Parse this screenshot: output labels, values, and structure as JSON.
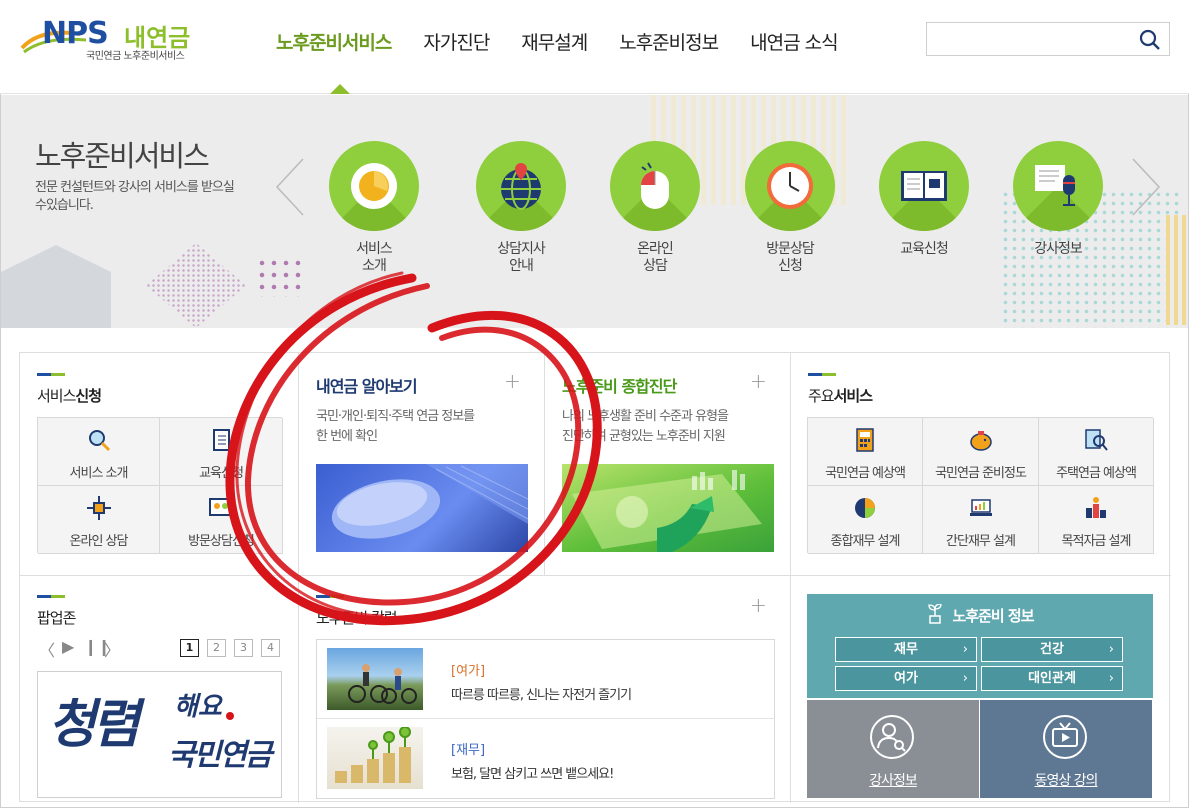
{
  "header": {
    "logo_nps": "NPS",
    "logo_name": "내연금",
    "logo_sub": "국민연금 노후준비서비스",
    "nav": [
      "노후준비서비스",
      "자가진단",
      "재무설계",
      "노후준비정보",
      "내연금 소식"
    ],
    "active_nav": 0,
    "search_placeholder": ""
  },
  "banner": {
    "title": "노후준비서비스",
    "desc": "전문 컨설턴트와 강사의 서비스를 받으실 수있습니다.",
    "services": [
      {
        "label": "서비스\n소개",
        "l1": "서비스",
        "l2": "소개",
        "icon": "clock-plate-icon"
      },
      {
        "label": "상담지사\n안내",
        "l1": "상담지사",
        "l2": "안내",
        "icon": "globe-pin-icon"
      },
      {
        "label": "온라인\n상담",
        "l1": "온라인",
        "l2": "상담",
        "icon": "mouse-icon"
      },
      {
        "label": "방문상담\n신청",
        "l1": "방문상담",
        "l2": "신청",
        "icon": "clock-icon"
      },
      {
        "label": "교육신청",
        "l1": "교육신청",
        "l2": "",
        "icon": "book-icon"
      },
      {
        "label": "강사정보",
        "l1": "강사정보",
        "l2": "",
        "icon": "microphone-icon"
      }
    ]
  },
  "service_apply": {
    "title_a": "서비스",
    "title_b": "신청",
    "items": [
      "서비스 소개",
      "교육신청",
      "온라인 상담",
      "방문상담신청"
    ]
  },
  "card1": {
    "title": "내연금 알아보기",
    "desc1": "국민·개인·퇴직·주택 연금 정보를",
    "desc2": "한 번에 확인"
  },
  "card2": {
    "title": "노후준비 종합진단",
    "desc1": "나의 노후생활 준비 수준과 유형을",
    "desc2": "진단하여 균형있는 노후준비 지원"
  },
  "main_services": {
    "title_a": "주요",
    "title_b": "서비스",
    "items": [
      "국민연금 예상액",
      "국민연금 준비정도",
      "주택연금 예상액",
      "종합재무 설계",
      "간단재무 설계",
      "목적자금 설계"
    ]
  },
  "popup": {
    "title": "팝업존",
    "pages": [
      "1",
      "2",
      "3",
      "4"
    ],
    "active_page": 0,
    "image_text_big": "청렴",
    "image_text_1": "해요",
    "image_text_2": "국민연금"
  },
  "news": {
    "title": "노후준비 칼럼",
    "items": [
      {
        "tag": "[여가]",
        "text": "따르릉 따르릉, 신나는 자전거 즐기기",
        "tag_color": "#d9702a"
      },
      {
        "tag": "[재무]",
        "text": "보험, 달면 삼키고 쓰면 뱉으세요!",
        "tag_color": "#3a66c2"
      }
    ]
  },
  "info": {
    "title": "노후준비 정보",
    "buttons": [
      "재무",
      "건강",
      "여가",
      "대인관계"
    ],
    "box1": "강사정보",
    "box2": "동영상 강의"
  },
  "colors": {
    "brand_green": "#8dbf2c",
    "brand_blue": "#1f4fa0",
    "info_teal": "#5fa8b0",
    "annotation_red": "#d7141a"
  }
}
